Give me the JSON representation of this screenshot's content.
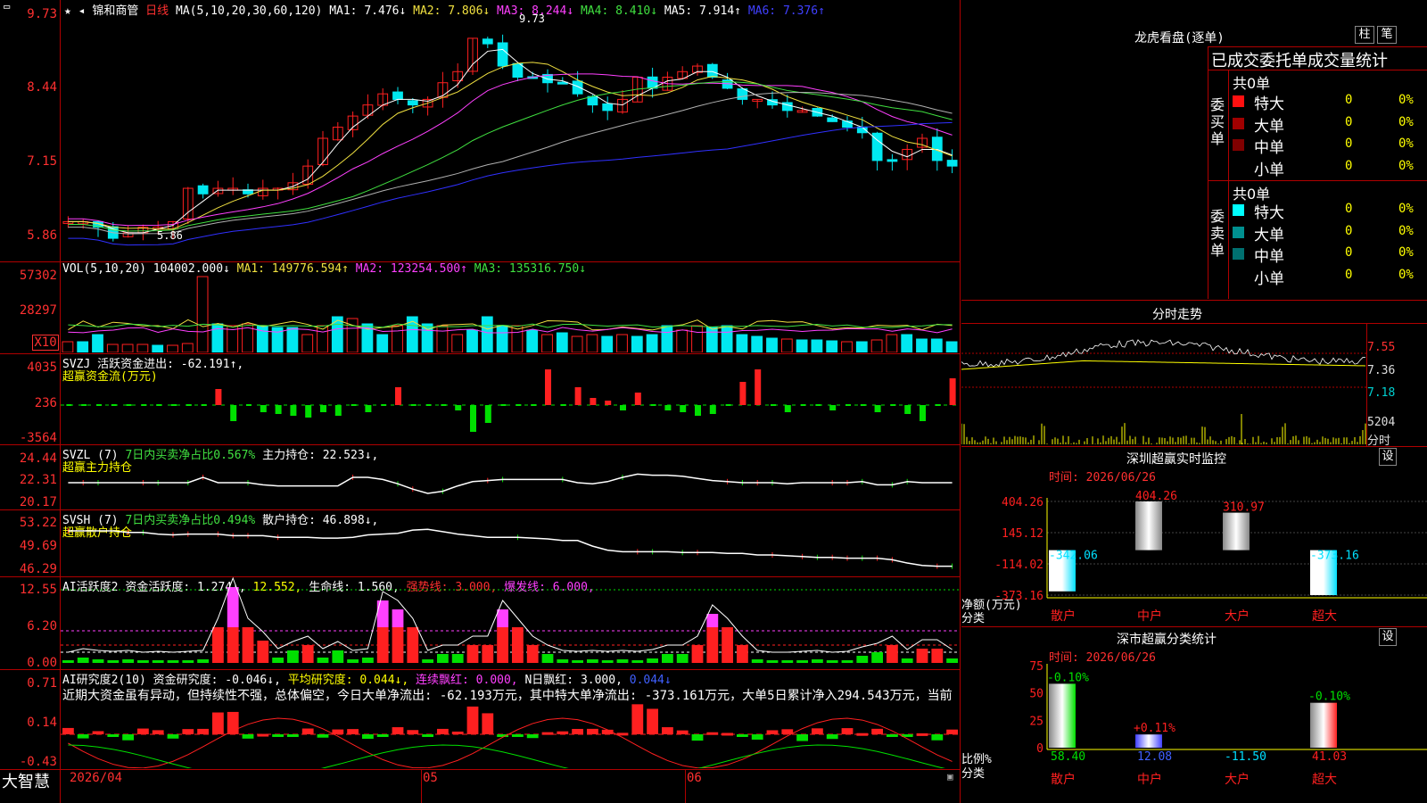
{
  "header": {
    "stock_name": "锦和商管",
    "period": "日线",
    "ma_label": "MA(5,10,20,30,60,120)",
    "ma1": "MA1: 7.476↓",
    "ma2": "MA2: 7.806↓",
    "ma3": "MA3: 8.244↓",
    "ma4": "MA4: 8.410↓",
    "ma5": "MA5: 7.914↑",
    "ma6": "MA6: 7.376↑",
    "star": "★",
    "peak_label": "9.73",
    "low_label": "5.86"
  },
  "colors": {
    "up": "#ff2020",
    "down": "#00e8f0",
    "ma1": "#ffffff",
    "ma2": "#f0e040",
    "ma3": "#ff40ff",
    "ma4": "#40e040",
    "ma5": "#b0b0b0",
    "ma6": "#3030ff",
    "grid": "#b00000",
    "pink": "#ff40ff",
    "green": "#00e000",
    "yellow": "#ffff00"
  },
  "price_axis": [
    "9.73",
    "8.44",
    "7.15",
    "5.86"
  ],
  "vol": {
    "title": "VOL(5,10,20)",
    "value": "104002.000↓",
    "ma1": "MA1: 149776.594↑",
    "ma2": "MA2: 123254.500↑",
    "ma3": "MA3: 135316.750↓",
    "axis": [
      "57302",
      "28297",
      "X10"
    ]
  },
  "svzj": {
    "title": "SVZJ  活跃资金进出: -62.191↑,",
    "sub": "超赢资金流(万元)",
    "axis": [
      "4035",
      "236",
      "-3564"
    ]
  },
  "svzl": {
    "title": "SVZL (7)",
    "ratio": "7日内买卖净占比0.567%",
    "hold": "主力持仓: 22.523↓,",
    "sub": "超赢主力持仓",
    "axis": [
      "24.44",
      "22.31",
      "20.17"
    ]
  },
  "svsh": {
    "title": "SVSH (7)",
    "ratio": "7日内买卖净占比0.494%",
    "hold": "散户持仓: 46.898↓,",
    "sub": "超赢散户持仓",
    "axis": [
      "53.22",
      "49.69",
      "46.29"
    ]
  },
  "ai_act": {
    "title": "AI活跃度2",
    "act": "资金活跃度: 1.274↓,",
    "v2": "12.552,",
    "life": "生命线: 1.560,",
    "strong": "强势线: 3.000,",
    "burst": "爆发线: 6.000,",
    "axis": [
      "12.55",
      "6.20",
      "0.00"
    ]
  },
  "ai_res": {
    "title": "AI研究度2(10)",
    "res": "资金研究度: -0.046↓,",
    "avg": "平均研究度: 0.044↓,",
    "red": "连续飘红: 0.000,",
    "n": "N日飘红: 3.000,",
    "last": "0.044↓",
    "comment": "近期大资金虽有异动，但持续性不强，总体偏空，今日大单净流出: -62.193万元，其中特大单净流出: -373.161万元，大单5日累计净入294.543万元，当前",
    "axis": [
      "0.71",
      "0.14",
      "-0.43"
    ]
  },
  "date_axis": [
    "2026/04",
    "05",
    "06"
  ],
  "footer": {
    "brand": "大智慧"
  },
  "longhu": {
    "title": "龙虎看盘(逐单)",
    "tab_bar": "柱",
    "tab_stroke": "笔",
    "subtitle": "已成交委托单成交量统计",
    "buy": {
      "label": "委买单",
      "total": "共0单",
      "rows": [
        {
          "name": "特大",
          "qty": "0",
          "pct": "0%",
          "color": "#ff1010"
        },
        {
          "name": "大单",
          "qty": "0",
          "pct": "0%",
          "color": "#a00000"
        },
        {
          "name": "中单",
          "qty": "0",
          "pct": "0%",
          "color": "#800000"
        },
        {
          "name": "小单",
          "qty": "0",
          "pct": "0%",
          "color": "#000000"
        }
      ]
    },
    "sell": {
      "label": "委卖单",
      "total": "共0单",
      "rows": [
        {
          "name": "特大",
          "qty": "0",
          "pct": "0%",
          "color": "#00ffff"
        },
        {
          "name": "大单",
          "qty": "0",
          "pct": "0%",
          "color": "#009090"
        },
        {
          "name": "中单",
          "qty": "0",
          "pct": "0%",
          "color": "#007070"
        },
        {
          "name": "小单",
          "qty": "0",
          "pct": "0%",
          "color": "#000000"
        }
      ]
    }
  },
  "intraday": {
    "title": "分时走势",
    "axis": [
      "7.55",
      "7.36",
      "7.18"
    ],
    "vol_label": "5204",
    "unit": "分时"
  },
  "sz_monitor": {
    "title": "深圳超赢实时监控",
    "set": "设",
    "time": "时间: 2026/06/26",
    "axis": [
      "404.26",
      "145.12",
      "-114.02",
      "-373.16"
    ],
    "y_title": "净额(万元)",
    "x_title": "分类",
    "cats": [
      "散户",
      "中户",
      "大户",
      "超大"
    ],
    "values": [
      -342.06,
      404.26,
      310.97,
      -373.16
    ],
    "labels": [
      "-342.06",
      "404.26",
      "310.97",
      "-373.16"
    ]
  },
  "sz_class": {
    "title": "深市超赢分类统计",
    "set": "设",
    "time": "时间: 2026/06/26",
    "axis": [
      "75",
      "50",
      "25",
      "0"
    ],
    "y_title": "比例%",
    "x_title": "分类",
    "cats": [
      "散户",
      "中户",
      "大户",
      "超大"
    ],
    "pct": [
      58.4,
      12.08,
      -11.5,
      41.03
    ],
    "pct_labels": [
      "58.40",
      "12.08",
      "-11.50",
      "41.03"
    ],
    "chg": [
      "-0.10%",
      "+0.11%",
      "",
      "-0.10%"
    ]
  }
}
